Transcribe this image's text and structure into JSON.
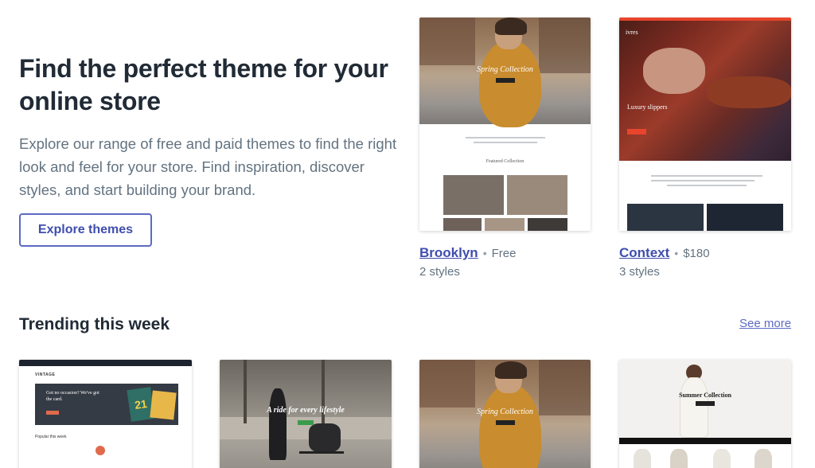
{
  "hero": {
    "title": "Find the perfect theme for your online store",
    "description": "Explore our range of free and paid themes to find the right look and feel for your store. Find inspiration, discover styles, and start building your brand.",
    "cta_label": "Explore themes"
  },
  "featured_themes": [
    {
      "name": "Brooklyn",
      "price": "Free",
      "styles": "2 styles",
      "preview_heading": "Spring Collection",
      "preview_subheading": "Featured Collection"
    },
    {
      "name": "Context",
      "price": "$180",
      "styles": "3 styles",
      "preview_heading": "Luxury slippers",
      "preview_brand": "ivres"
    }
  ],
  "trending": {
    "title": "Trending this week",
    "see_more_label": "See more",
    "cards": [
      {
        "preview_brand": "VINTAGE",
        "preview_heading": "Got no occasion? We've got the card.",
        "preview_number": "21",
        "preview_footer": "Popular this week"
      },
      {
        "preview_heading": "A ride for every lifestyle"
      },
      {
        "preview_heading": "Spring Collection"
      },
      {
        "preview_heading": "Summer Collection"
      }
    ]
  },
  "colors": {
    "accent": "#5c6ac4",
    "link": "#3f4eae",
    "heading": "#212b36",
    "body_text": "#637381",
    "context_banner": "#e8452c"
  },
  "separator": "•"
}
